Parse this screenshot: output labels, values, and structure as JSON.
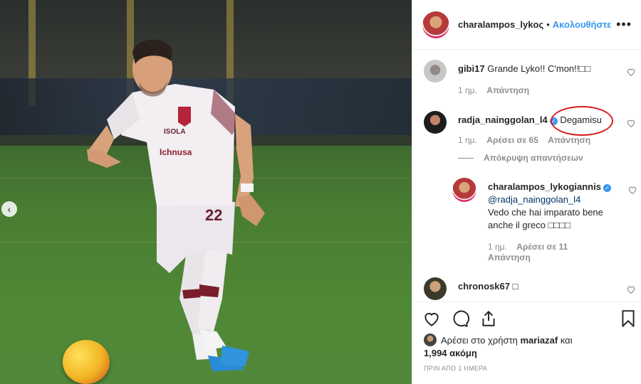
{
  "header": {
    "username": "charalampos_lykoς",
    "separator": "•",
    "follow_label": "Ακολουθήστε",
    "more_label": "•••"
  },
  "carousel": {
    "prev_label": "‹"
  },
  "comments": [
    {
      "username": "gibi17",
      "text": "Grande Lyko!! C'mon!!□□",
      "time": "1 ημ.",
      "reply_label": "Απάντηση"
    },
    {
      "username": "radja_nainggolan_l4",
      "text": "Degamisu",
      "time": "1 ημ.",
      "likes_label": "Αρέσει σε 65",
      "reply_label": "Απάντηση",
      "hide_replies_label": "Απόκρυψη απαντήσεων",
      "replies": [
        {
          "username": "charalampos_lykogiannis",
          "mention": "@radja_nainggolan_l4",
          "text": "Vedo che hai imparato bene anche il greco □□□□",
          "time": "1 ημ.",
          "likes_label": "Αρέσει σε 11",
          "reply_label": "Απάντηση"
        }
      ]
    },
    {
      "username": "chronosk67",
      "text": "□"
    }
  ],
  "likes": {
    "prefix": "Αρέσει στο χρήστη",
    "user": "mariazaf",
    "connector": "και",
    "count": "1,994 ακόμη"
  },
  "timestamp": "ΠΡΙΝ ΑΠΟ 1 ΗΜΕΡΑ",
  "player": {
    "shirt_text_1": "ISOLA",
    "shirt_text_2": "Ichnusa",
    "number": "22"
  },
  "colors": {
    "accent": "#3897f0",
    "highlight": "#d81e1e"
  }
}
